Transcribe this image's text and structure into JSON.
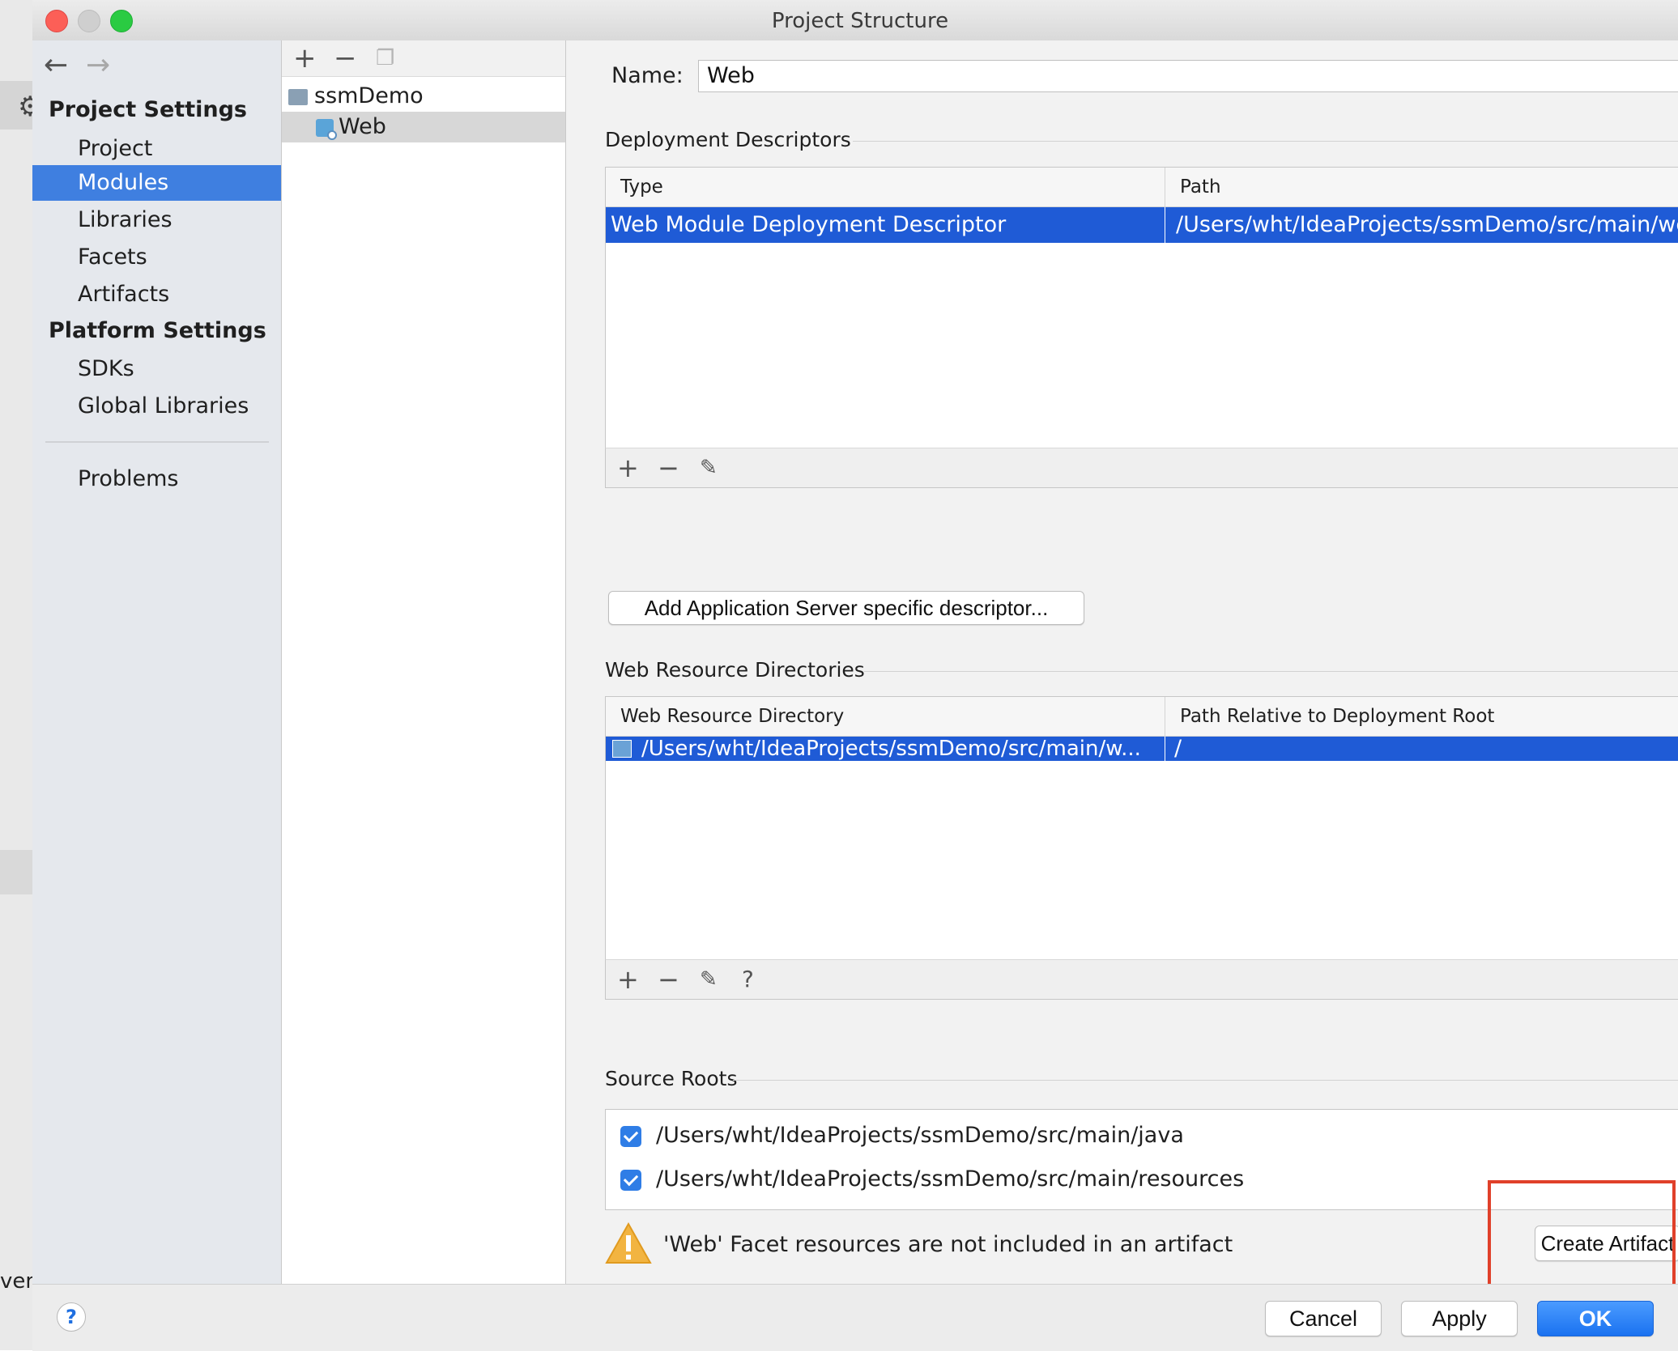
{
  "window": {
    "title": "Project Structure"
  },
  "background": {
    "cut_label": "ven"
  },
  "sidebar": {
    "back": "←",
    "forward": "→",
    "project_settings_header": "Project Settings",
    "project_items": [
      "Project",
      "Modules",
      "Libraries",
      "Facets",
      "Artifacts"
    ],
    "platform_settings_header": "Platform Settings",
    "platform_items": [
      "SDKs",
      "Global Libraries"
    ],
    "problems": "Problems",
    "selected": "Modules"
  },
  "module_tree": {
    "add": "+",
    "remove": "−",
    "root": "ssmDemo",
    "child": "Web"
  },
  "facet": {
    "name_label": "Name:",
    "name_value": "Web",
    "deployment_descriptors": {
      "title": "Deployment Descriptors",
      "columns": [
        "Type",
        "Path"
      ],
      "rows": [
        {
          "type": "Web Module Deployment Descriptor",
          "path": "/Users/wht/IdeaProjects/ssmDemo/src/main/webapp/WEB-INF/web.xml"
        }
      ],
      "toolbar": {
        "add": "+",
        "remove": "−",
        "edit": "✎"
      }
    },
    "add_server_descriptor_button": "Add Application Server specific descriptor...",
    "web_resource_directories": {
      "title": "Web Resource Directories",
      "columns": [
        "Web Resource Directory",
        "Path Relative to Deployment Root"
      ],
      "rows": [
        {
          "directory": "/Users/wht/IdeaProjects/ssmDemo/src/main/w...",
          "relative": "/"
        }
      ],
      "toolbar": {
        "add": "+",
        "remove": "−",
        "edit": "✎",
        "help": "?"
      }
    },
    "source_roots": {
      "title": "Source Roots",
      "items": [
        {
          "path": "/Users/wht/IdeaProjects/ssmDemo/src/main/java",
          "checked": true
        },
        {
          "path": "/Users/wht/IdeaProjects/ssmDemo/src/main/resources",
          "checked": true
        }
      ]
    },
    "warning_text": "'Web' Facet resources are not included in an artifact",
    "create_artifact_button": "Create Artifact"
  },
  "footer": {
    "help": "?",
    "cancel": "Cancel",
    "apply": "Apply",
    "ok": "OK"
  },
  "colors": {
    "selection": "#1f5bd6",
    "sidebar_selection": "#3f7fe0",
    "highlight_box": "#e0402a"
  }
}
